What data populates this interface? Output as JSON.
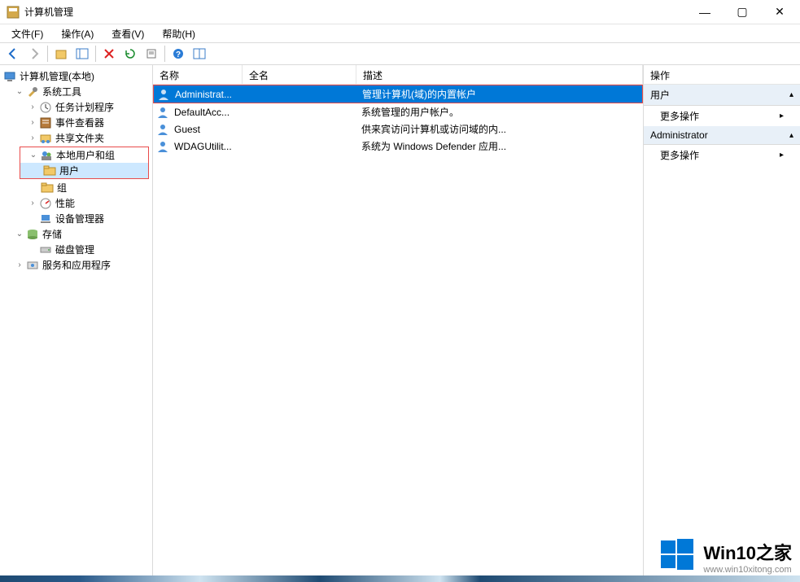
{
  "window": {
    "title": "计算机管理",
    "controls": {
      "min": "—",
      "max": "▢",
      "close": "✕"
    }
  },
  "menu": {
    "file": "文件(F)",
    "action": "操作(A)",
    "view": "查看(V)",
    "help": "帮助(H)"
  },
  "tree": {
    "root": "计算机管理(本地)",
    "system_tools": "系统工具",
    "task_scheduler": "任务计划程序",
    "event_viewer": "事件查看器",
    "shared_folders": "共享文件夹",
    "local_users_groups": "本地用户和组",
    "users": "用户",
    "groups": "组",
    "performance": "性能",
    "device_manager": "设备管理器",
    "storage": "存储",
    "disk_management": "磁盘管理",
    "services_apps": "服务和应用程序"
  },
  "list": {
    "headers": {
      "name": "名称",
      "fullname": "全名",
      "desc": "描述"
    },
    "rows": [
      {
        "name": "Administrat...",
        "fullname": "",
        "desc": "管理计算机(域)的内置帐户",
        "selected": true
      },
      {
        "name": "DefaultAcc...",
        "fullname": "",
        "desc": "系统管理的用户帐户。",
        "selected": false
      },
      {
        "name": "Guest",
        "fullname": "",
        "desc": "供来宾访问计算机或访问域的内...",
        "selected": false
      },
      {
        "name": "WDAGUtilit...",
        "fullname": "",
        "desc": "系统为 Windows Defender 应用...",
        "selected": false
      }
    ]
  },
  "actions": {
    "header": "操作",
    "section1": "用户",
    "section2": "Administrator",
    "more": "更多操作"
  },
  "watermark": {
    "title": "Win10之家",
    "url": "www.win10xitong.com"
  }
}
